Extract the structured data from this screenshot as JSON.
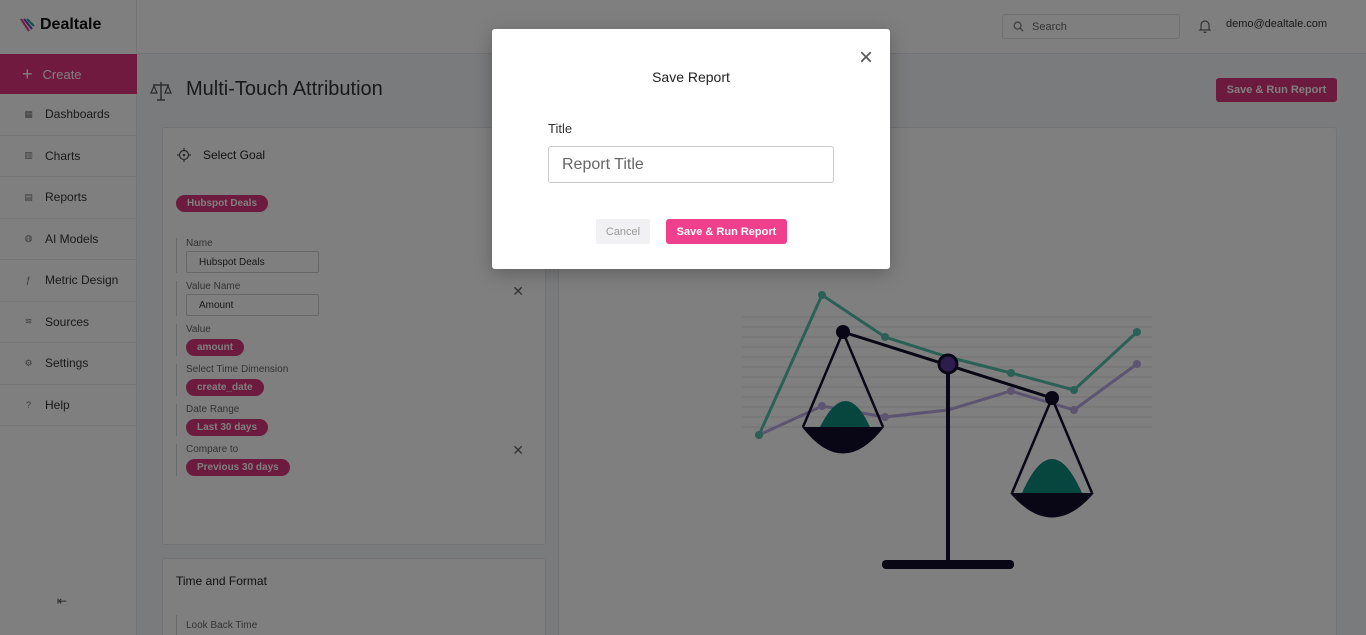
{
  "app": {
    "name": "Dealtale",
    "brand_color": "#e0357f"
  },
  "sidebar": {
    "create_label": "Create",
    "items": [
      {
        "label": "Dashboards",
        "icon": "dashboard-icon"
      },
      {
        "label": "Charts",
        "icon": "bar-chart-icon"
      },
      {
        "label": "Reports",
        "icon": "report-icon"
      },
      {
        "label": "AI Models",
        "icon": "ai-model-icon"
      },
      {
        "label": "Metric Design",
        "icon": "function-icon"
      },
      {
        "label": "Sources",
        "icon": "database-icon"
      },
      {
        "label": "Settings",
        "icon": "gear-icon"
      },
      {
        "label": "Help",
        "icon": "help-icon"
      }
    ]
  },
  "topbar": {
    "search_placeholder": "Search",
    "user_email": "demo@dealtale.com"
  },
  "page": {
    "title": "Multi-Touch Attribution",
    "save_run_label": "Save & Run Report"
  },
  "goal_panel": {
    "title": "Select Goal",
    "goal_chip": "Hubspot Deals",
    "fields": {
      "name_label": "Name",
      "name_value": "Hubspot Deals",
      "value_name_label": "Value Name",
      "value_name_value": "Amount",
      "value_label": "Value",
      "value_chip": "amount",
      "time_dim_label": "Select Time Dimension",
      "time_dim_chip": "create_date",
      "date_range_label": "Date Range",
      "date_range_chip": "Last 30 days",
      "compare_label": "Compare to",
      "compare_chip": "Previous 30 days"
    }
  },
  "time_panel": {
    "title": "Time and Format",
    "look_back_label": "Look Back Time"
  },
  "modal": {
    "title": "Save Report",
    "field_label": "Title",
    "input_placeholder": "Report Title",
    "input_value": "",
    "cancel_label": "Cancel",
    "save_label": "Save & Run Report"
  }
}
